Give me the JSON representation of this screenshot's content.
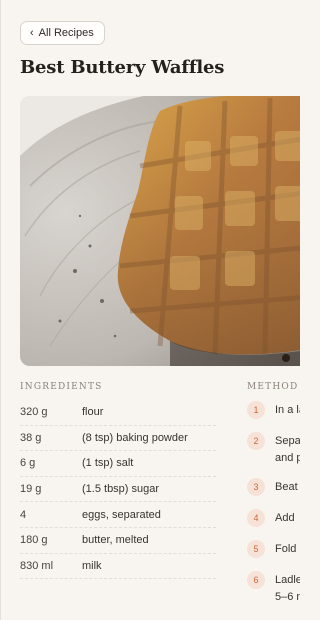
{
  "nav": {
    "back_label": "All Recipes",
    "back_icon": "chevron-left-icon"
  },
  "recipe": {
    "title": "Best Buttery Waffles"
  },
  "sections": {
    "ingredients": "INGREDIENTS",
    "method": "METHOD"
  },
  "ingredients": [
    {
      "qty": "320 g",
      "name": "flour"
    },
    {
      "qty": "38 g",
      "name": "(8 tsp) baking powder"
    },
    {
      "qty": "6 g",
      "name": "(1 tsp) salt"
    },
    {
      "qty": "19 g",
      "name": "(1.5 tbsp) sugar"
    },
    {
      "qty": "4",
      "name": "eggs, separated"
    },
    {
      "qty": "180 g",
      "name": "butter, melted"
    },
    {
      "qty": "830 ml",
      "name": "milk"
    }
  ],
  "method": [
    {
      "num": "1",
      "text": "In a la"
    },
    {
      "num": "2",
      "text": "Sepa\nand p"
    },
    {
      "num": "3",
      "text": "Beat"
    },
    {
      "num": "4",
      "text": "Add"
    },
    {
      "num": "5",
      "text": "Fold"
    },
    {
      "num": "6",
      "text": "Ladle\n5–6 n"
    }
  ],
  "colors": {
    "background": "#f8f5f1",
    "step_badge_bg": "#f6e2d6",
    "step_badge_text": "#c86a3c"
  }
}
